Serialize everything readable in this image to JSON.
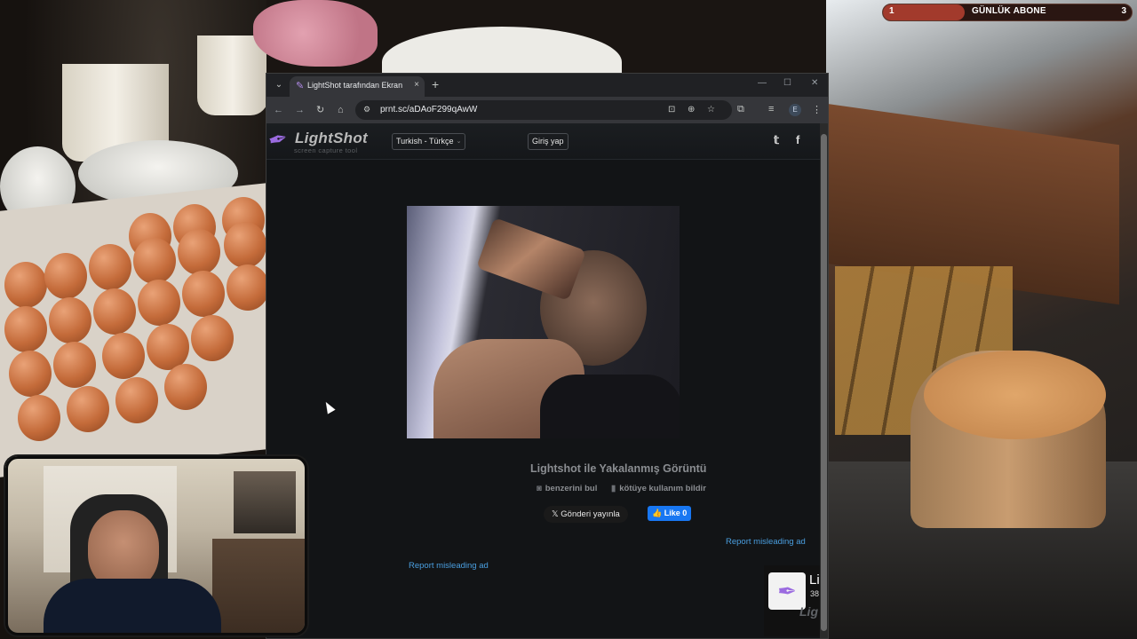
{
  "stream_overlay": {
    "goal_current": "1",
    "goal_label": "GÜNLÜK ABONE",
    "goal_max": "3",
    "goal_progress": 0.33,
    "goal_color": "#a23a2c"
  },
  "browser": {
    "tab": {
      "favicon": "lightshot-feather-icon",
      "title": "LightShot tarafından Ekran Görüntüsü",
      "close_icon": "×"
    },
    "new_tab_icon": "+",
    "window_controls": [
      "—",
      "☐",
      "✕"
    ],
    "nav": {
      "back_icon": "←",
      "forward_icon": "→",
      "reload_icon": "↻",
      "home_icon": "⌂"
    },
    "omnibox": {
      "info_icon": "⚙",
      "url": "prnt.sc/aDAoF299qAwW",
      "install_icon": "⊡",
      "zoom_icon": "⊕",
      "bookmark_icon": "☆"
    },
    "toolbar_icons": {
      "extensions": "⧉",
      "media": "≡",
      "profile_initial": "E",
      "menu": "⋮"
    }
  },
  "site": {
    "logo_text": "LightShot",
    "logo_subtitle": "screen capture tool",
    "language": "Turkish - Türkçe",
    "login": "Giriş yap",
    "social": {
      "twitter": "𝕥",
      "facebook": "f"
    },
    "screenshot_caption": "Lightshot ile Yakalanmış Görüntü",
    "find_similar": "benzerini bul",
    "report_abuse": "kötüye kullanım bildir",
    "tweet_button": "Gönderi yayınla",
    "tweet_icon": "𝕏",
    "like_button": "Like 0",
    "report_ad_1": "Report misleading ad",
    "report_ad_2": "Report misleading ad",
    "ad_widget": {
      "title": "Li",
      "count": "38",
      "brand": "Lig"
    }
  }
}
